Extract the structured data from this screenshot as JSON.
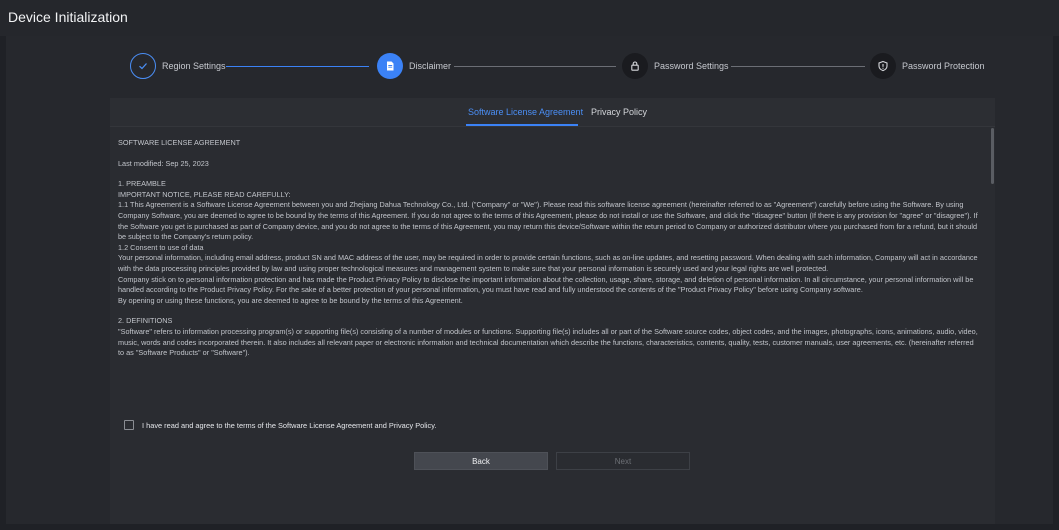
{
  "window": {
    "title": "Device Initialization"
  },
  "stepper": {
    "steps": [
      {
        "label": "Region Settings",
        "state": "done",
        "icon": "check-icon"
      },
      {
        "label": "Disclaimer",
        "state": "active",
        "icon": "document-icon"
      },
      {
        "label": "Password Settings",
        "state": "pending",
        "icon": "lock-icon"
      },
      {
        "label": "Password Protection",
        "state": "pending",
        "icon": "shield-icon"
      }
    ]
  },
  "tabs": [
    {
      "label": "Software License Agreement",
      "active": true
    },
    {
      "label": "Privacy Policy",
      "active": false
    }
  ],
  "license": {
    "heading": "SOFTWARE LICENSE AGREEMENT",
    "modified": "Last modified: Sep 25, 2023",
    "section1_title": "1. PREAMBLE",
    "notice": "IMPORTANT NOTICE, PLEASE READ CAREFULLY:",
    "p1_1": "1.1 This Agreement is a Software License Agreement between you and Zhejiang Dahua Technology Co., Ltd. (\"Company\" or \"We\"). Please read this software license agreement (hereinafter referred to as \"Agreement\") carefully before using the Software. By using Company Software, you are deemed to agree to be bound by the terms of this Agreement. If you do not agree to the terms of this Agreement, please do not install or use the Software, and click the \"disagree\" button (If there is any provision for \"agree\" or \"disagree\"). If the Software you get is purchased as part of Company device, and you do not agree to the terms of this Agreement, you may return this device/Software within the return period to Company or authorized distributor where you purchased from for a refund, but it should be subject to the Company's return policy.",
    "p1_2_title": "1.2 Consent to use of data",
    "p1_2": "Your personal information, including email address, product SN and MAC address of the user, may be required in order to provide certain functions, such as on-line updates, and resetting password. When dealing with such information, Company will act in accordance with the data processing principles provided by law and using proper technological measures and management system to make sure that your personal information is securely used and your legal rights are well protected.",
    "p1_3": "Company stick on to personal information protection and has made the Product Privacy Policy to disclose the important information about the collection, usage, share, storage, and deletion of personal information. In all circumstance, your personal information will be handled according to the Product Privacy Policy. For the sake of a better protection of your personal information, you must have read and fully understood the contents of the \"Product Privacy Policy\" before using Company software.",
    "p1_4": "By opening or using these functions, you are deemed to agree to be bound by the terms of this Agreement.",
    "section2_title": "2. DEFINITIONS",
    "p2_1": "\"Software\" refers to information processing program(s) or supporting file(s) consisting of a number of modules or functions. Supporting file(s) includes all or part of the Software source codes, object codes, and the images, photographs, icons, animations, audio, video, music, words and codes incorporated therein. It also includes all relevant paper or electronic information and technical documentation which describe the functions, characteristics, contents, quality, tests, customer manuals, user agreements, etc. (hereinafter referred to as \"Software Products\" or \"Software\")."
  },
  "agreement": {
    "label": "I have read and agree to the terms of the Software License Agreement and Privacy Policy.",
    "checked": false
  },
  "buttons": {
    "back": "Back",
    "next": "Next",
    "next_enabled": false
  },
  "colors": {
    "accent": "#3b82f6",
    "background": "#1f2126",
    "panel": "#2a2c31"
  }
}
